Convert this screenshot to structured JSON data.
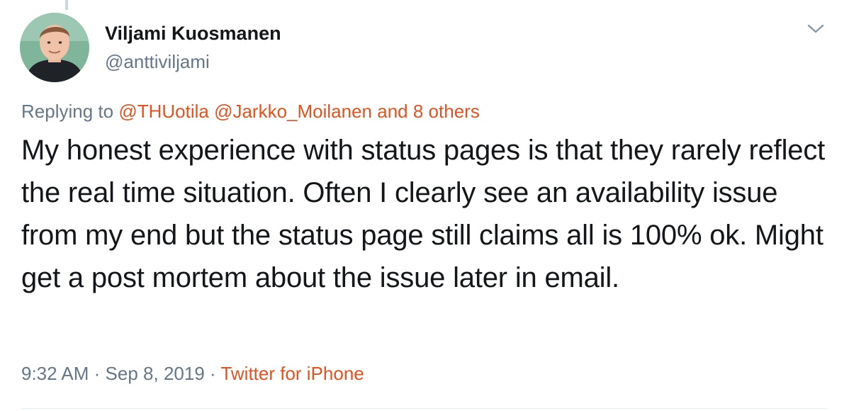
{
  "tweet": {
    "author": {
      "display_name": "Viljami Kuosmanen",
      "handle": "@anttiviljami",
      "avatar_icon": "user-avatar-photo"
    },
    "menu_icon": "chevron-down-icon",
    "replying": {
      "prefix": "Replying to",
      "mentions": [
        "@THUotila",
        "@Jarkko_Moilanen"
      ],
      "others": "and 8 others"
    },
    "text": "My honest experience with status pages is that they rarely reflect the real time situation. Often I clearly see an availability issue from my end but the status page still claims all is 100% ok. Might get a post mortem about the issue later in email.",
    "time": "9:32 AM",
    "separator": "·",
    "date": "Sep 8, 2019",
    "source": "Twitter for iPhone"
  },
  "colors": {
    "accent": "#e0531f",
    "secondary_text": "#657786",
    "primary_text": "#14171a",
    "divider": "#e6ecf0"
  }
}
